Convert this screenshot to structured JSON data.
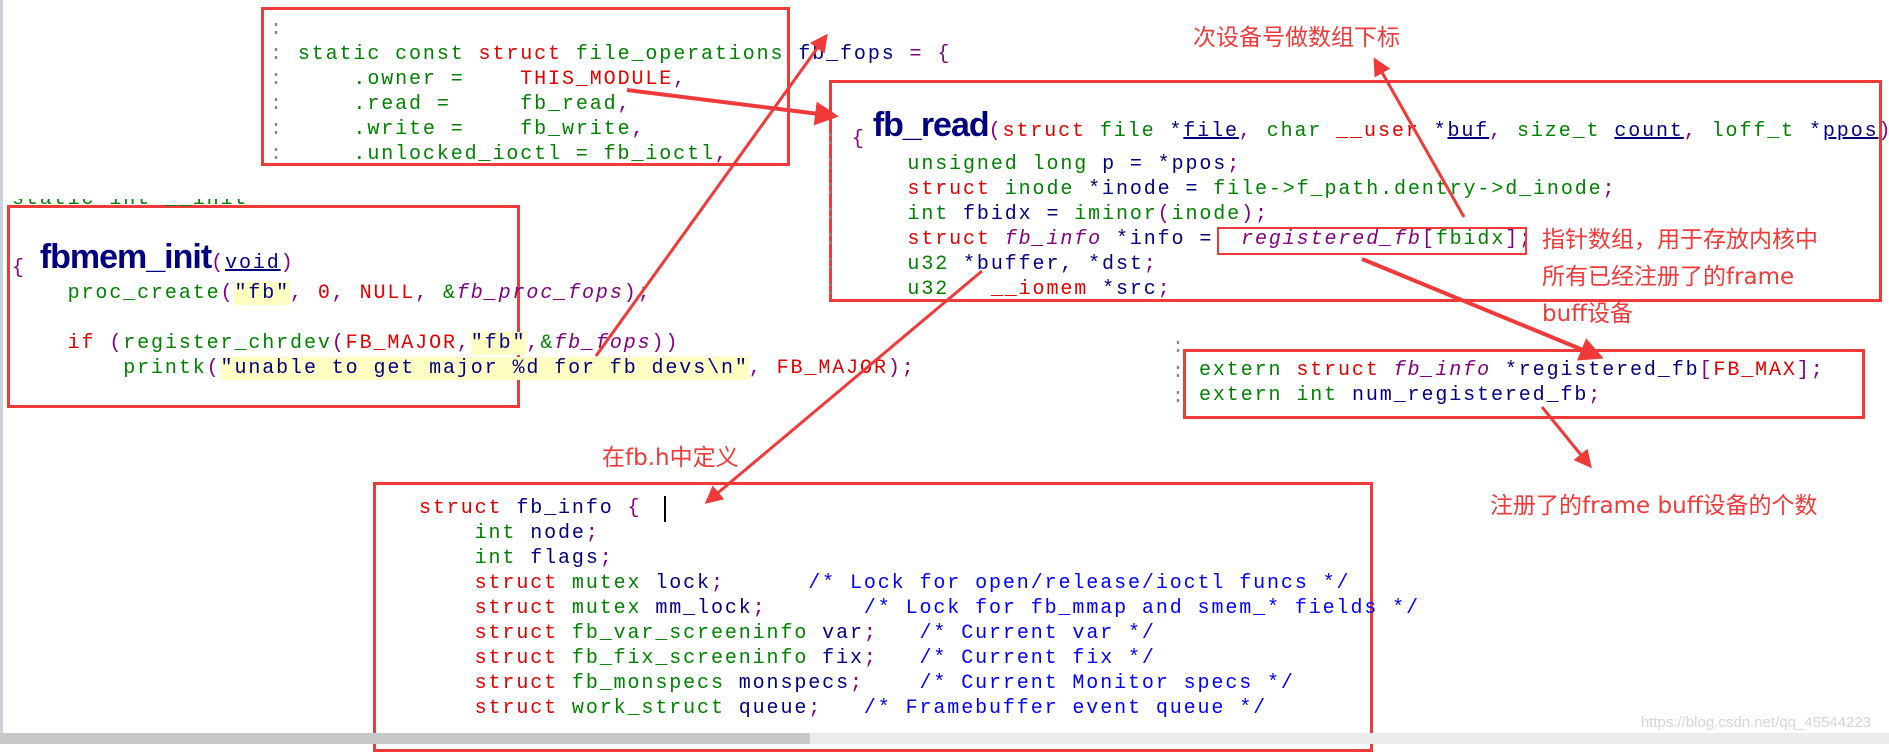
{
  "colors": {
    "annotation": "#f03a3a",
    "keyword": "#e00000",
    "type": "#008000",
    "identifier": "#000080",
    "param": "#800080",
    "comment": "#0000ff",
    "string_bg": "#ffffc4"
  },
  "fops_block": {
    "lines": [
      [
        [
          ":",
          "colon"
        ]
      ],
      [
        [
          ": ",
          "colon"
        ],
        [
          "static const ",
          "g"
        ],
        [
          "struct ",
          "k"
        ],
        [
          "file_operations ",
          "g"
        ],
        [
          "fb_fops ",
          "n"
        ],
        [
          "= {",
          "pu"
        ]
      ],
      [
        [
          ":     ",
          "colon"
        ],
        [
          ".owner =    ",
          "g"
        ],
        [
          "THIS_MODULE",
          "k"
        ],
        [
          ",",
          "pu"
        ]
      ],
      [
        [
          ":     ",
          "colon"
        ],
        [
          ".read =     ",
          "g"
        ],
        [
          "fb_read",
          "g"
        ],
        [
          ",",
          "pu"
        ]
      ],
      [
        [
          ":     ",
          "colon"
        ],
        [
          ".write =    ",
          "g"
        ],
        [
          "fb_write",
          "g"
        ],
        [
          ",",
          "pu"
        ]
      ],
      [
        [
          ":     ",
          "colon"
        ],
        [
          ".unlocked_ioctl = fb_ioctl",
          "g"
        ],
        [
          ",",
          "pu"
        ]
      ]
    ]
  },
  "fb_read_block": {
    "func_name": "fb_read",
    "lines": [
      [
        [
          "(",
          "pu"
        ],
        [
          "struct ",
          "k"
        ],
        [
          "file ",
          "g"
        ],
        [
          "*",
          "n"
        ],
        [
          "file",
          "n u"
        ],
        [
          ", ",
          "pu"
        ],
        [
          "char ",
          "g"
        ],
        [
          "__user ",
          "k"
        ],
        [
          "*",
          "n"
        ],
        [
          "buf",
          "n u"
        ],
        [
          ", ",
          "pu"
        ],
        [
          "size_t ",
          "g"
        ],
        [
          "count",
          "n u"
        ],
        [
          ", ",
          "pu"
        ],
        [
          "loff_t ",
          "g"
        ],
        [
          "*",
          "n"
        ],
        [
          "ppos",
          "n u"
        ],
        [
          ")",
          "pu"
        ]
      ],
      [
        [
          "{",
          "pu"
        ]
      ],
      [
        [
          "    unsigned long ",
          "g"
        ],
        [
          "p = *",
          "n"
        ],
        [
          "ppos",
          ""
        ],
        [
          ";",
          "pu"
        ]
      ],
      [
        [
          "    struct ",
          "k"
        ],
        [
          "inode ",
          "g"
        ],
        [
          "*inode = ",
          "n"
        ],
        [
          "file->f_path.dentry->d_inode",
          "g"
        ],
        [
          ";",
          "pu"
        ]
      ],
      [
        [
          "    int ",
          "g"
        ],
        [
          "fbidx = ",
          "n"
        ],
        [
          "iminor",
          "g"
        ],
        [
          "(",
          "pu"
        ],
        [
          "inode",
          "g"
        ],
        [
          ");",
          "pu"
        ]
      ],
      [
        [
          "    struct ",
          "k"
        ],
        [
          "fb_info ",
          "p"
        ],
        [
          "*info = ",
          "n"
        ],
        [
          " registered_fb",
          "p"
        ],
        [
          "[",
          "pu"
        ],
        [
          "fbidx",
          "g"
        ],
        [
          "];",
          "pu"
        ]
      ],
      [
        [
          "    u32 ",
          "g"
        ],
        [
          "*buffer, *dst",
          "n"
        ],
        [
          ";",
          "pu"
        ]
      ],
      [
        [
          "    u32 ",
          "g"
        ],
        [
          "  __iomem ",
          "k"
        ],
        [
          "*src",
          "n"
        ],
        [
          ";",
          "pu"
        ]
      ]
    ]
  },
  "fbmem_block": {
    "clipped_line": "static int __init",
    "func_name": "fbmem_init",
    "lines": [
      [
        [
          "(",
          "pu"
        ],
        [
          "void",
          "n u"
        ],
        [
          ")",
          "pu"
        ]
      ],
      [
        [
          "{",
          "pu"
        ]
      ],
      [
        [
          "    proc_create",
          "g"
        ],
        [
          "(",
          "pu"
        ],
        [
          "\"fb\"",
          "s"
        ],
        [
          ", ",
          "pu"
        ],
        [
          "0",
          "k"
        ],
        [
          ", ",
          "pu"
        ],
        [
          "NULL",
          "k"
        ],
        [
          ", ",
          "pu"
        ],
        [
          "&",
          "g"
        ],
        [
          "fb_proc_fops",
          "p"
        ],
        [
          ");",
          "pu"
        ]
      ],
      [
        [
          "",
          ""
        ]
      ],
      [
        [
          "    if ",
          "k"
        ],
        [
          "(",
          "pu"
        ],
        [
          "register_chrdev",
          "g"
        ],
        [
          "(",
          "pu"
        ],
        [
          "FB_MAJOR",
          "k"
        ],
        [
          ",",
          "pu"
        ],
        [
          "\"fb\"",
          "s"
        ],
        [
          ",",
          "pu"
        ],
        [
          "&",
          "g"
        ],
        [
          "fb_fops",
          "p"
        ],
        [
          "))",
          "pu"
        ]
      ],
      [
        [
          "        printk",
          "g"
        ],
        [
          "(",
          "pu"
        ],
        [
          "\"unable to get major %d for fb devs\\n\"",
          "s"
        ],
        [
          ", ",
          "pu"
        ],
        [
          "FB_MAJOR",
          "k"
        ],
        [
          ");",
          "pu"
        ]
      ]
    ]
  },
  "extern_block": {
    "lines": [
      [
        [
          "extern ",
          "g"
        ],
        [
          "struct ",
          "k"
        ],
        [
          "fb_info ",
          "p"
        ],
        [
          "*registered_fb",
          "n"
        ],
        [
          "[",
          "pu"
        ],
        [
          "FB_MAX",
          "k"
        ],
        [
          "];",
          "pu"
        ]
      ],
      [
        [
          "extern ",
          "g"
        ],
        [
          "int ",
          "g"
        ],
        [
          "num_registered_fb",
          "n"
        ],
        [
          ";",
          "pu"
        ]
      ]
    ]
  },
  "fb_info_block": {
    "lines": [
      [
        [
          "struct ",
          "k"
        ],
        [
          "fb_info ",
          "n"
        ],
        [
          "{",
          "pu"
        ]
      ],
      [
        [
          "    int ",
          "g"
        ],
        [
          "node",
          "n"
        ],
        [
          ";",
          "pu"
        ]
      ],
      [
        [
          "    int ",
          "g"
        ],
        [
          "flags",
          "n"
        ],
        [
          ";",
          "pu"
        ]
      ],
      [
        [
          "    struct ",
          "k"
        ],
        [
          "mutex ",
          "g"
        ],
        [
          "lock",
          "n"
        ],
        [
          ";",
          "pu"
        ],
        [
          "      /* Lock for open/release/ioctl funcs */",
          "c"
        ]
      ],
      [
        [
          "    struct ",
          "k"
        ],
        [
          "mutex ",
          "g"
        ],
        [
          "mm_lock",
          "n"
        ],
        [
          ";",
          "pu"
        ],
        [
          "       /* Lock for fb_mmap and smem_* fields */",
          "c"
        ]
      ],
      [
        [
          "    struct ",
          "k"
        ],
        [
          "fb_var_screeninfo ",
          "g"
        ],
        [
          "var",
          "n"
        ],
        [
          ";",
          "pu"
        ],
        [
          "   /* Current var */",
          "c"
        ]
      ],
      [
        [
          "    struct ",
          "k"
        ],
        [
          "fb_fix_screeninfo ",
          "g"
        ],
        [
          "fix",
          "n"
        ],
        [
          ";",
          "pu"
        ],
        [
          "   /* Current fix */",
          "c"
        ]
      ],
      [
        [
          "    struct ",
          "k"
        ],
        [
          "fb_monspecs ",
          "g"
        ],
        [
          "monspecs",
          "n"
        ],
        [
          ";",
          "pu"
        ],
        [
          "    /* Current Monitor specs */",
          "c"
        ]
      ],
      [
        [
          "    struct ",
          "k"
        ],
        [
          "work_struct ",
          "g"
        ],
        [
          "queue",
          "n"
        ],
        [
          ";",
          "pu"
        ],
        [
          "   /* Framebuffer event queue */",
          "c"
        ]
      ]
    ]
  },
  "annotations": {
    "minor_index": "次设备号做数组下标",
    "pointer_array": [
      "指针数组，用于存放内核中",
      "所有已经注册了的frame",
      "buff设备"
    ],
    "defined_in": "在fb.h中定义",
    "count": "注册了的frame buff设备的个数"
  },
  "watermark": "https://blog.csdn.net/qq_45544223"
}
